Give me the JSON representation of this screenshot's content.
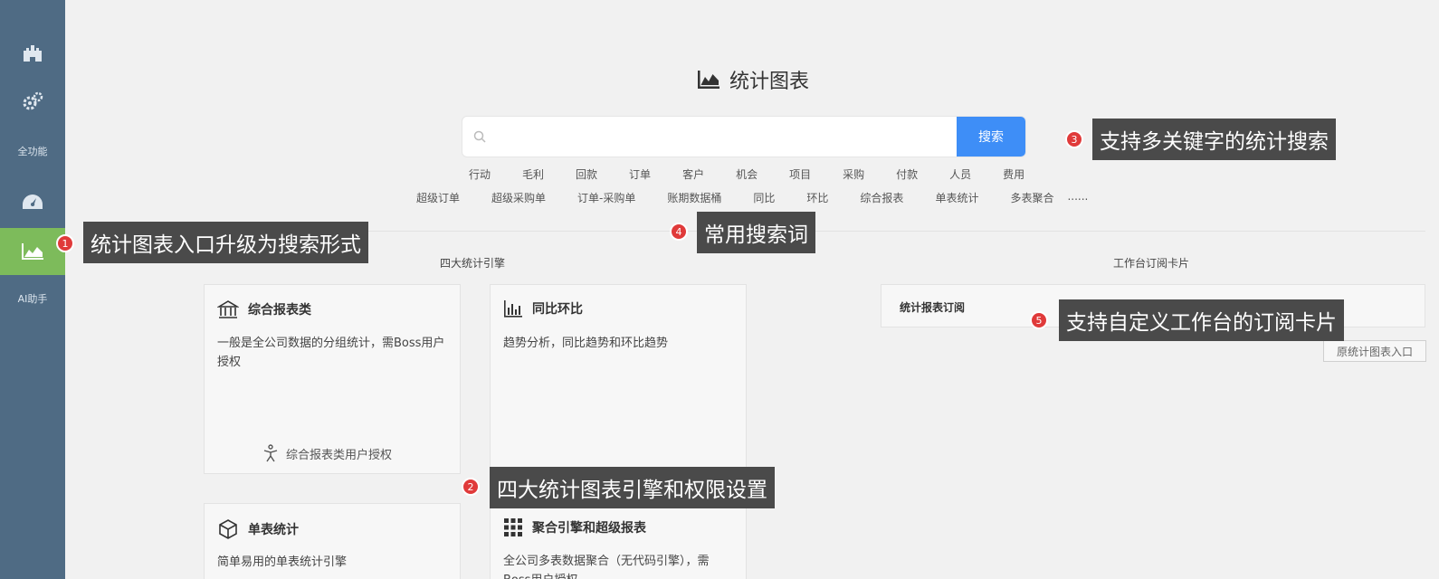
{
  "sidebar": {
    "items": [
      {
        "icon": "castle-icon"
      },
      {
        "icon": "gears-icon"
      },
      {
        "label": "全功能"
      },
      {
        "icon": "dashboard-icon"
      },
      {
        "icon": "area-chart-icon",
        "active": true
      },
      {
        "label": "AI助手"
      }
    ]
  },
  "header": {
    "title": "统计图表",
    "icon": "area-chart-icon"
  },
  "search": {
    "placeholder": "",
    "button_label": "搜索"
  },
  "keywords": {
    "row1": [
      "行动",
      "毛利",
      "回款",
      "订单",
      "客户",
      "机会",
      "项目",
      "采购",
      "付款",
      "人员",
      "费用"
    ],
    "row2": [
      "超级订单",
      "超级采购单",
      "订单-采购单",
      "账期数据桶",
      "同比",
      "环比",
      "综合报表",
      "单表统计",
      "多表聚合",
      "......"
    ]
  },
  "engines": {
    "section_title": "四大统计引擎",
    "cards": [
      {
        "title": "综合报表类",
        "icon": "bank-icon",
        "desc": "一般是全公司数据的分组统计，需Boss用户授权",
        "footer": "综合报表类用户授权",
        "footer_icon": "accessibility-icon"
      },
      {
        "title": "同比环比",
        "icon": "bar-chart-icon",
        "desc": "趋势分析，同比趋势和环比趋势"
      },
      {
        "title": "单表统计",
        "icon": "cube-icon",
        "desc": "简单易用的单表统计引擎"
      },
      {
        "title": "聚合引擎和超级报表",
        "icon": "grid-icon",
        "desc": "全公司多表数据聚合（无代码引擎），需Boss用户授权"
      }
    ]
  },
  "workbench": {
    "section_title": "工作台订阅卡片",
    "card_title": "统计报表订阅",
    "old_entry_label": "原统计图表入口"
  },
  "annotations": [
    {
      "num": "1",
      "text": "统计图表入口升级为搜索形式"
    },
    {
      "num": "2",
      "text": "四大统计图表引擎和权限设置"
    },
    {
      "num": "3",
      "text": "支持多关键字的统计搜索"
    },
    {
      "num": "4",
      "text": "常用搜索词"
    },
    {
      "num": "5",
      "text": "支持自定义工作台的订阅卡片"
    }
  ],
  "colors": {
    "sidebar": "#4f6b84",
    "active": "#7dbb5b",
    "search_button": "#3e8ef7",
    "annotation_dot": "#e03a3a",
    "annotation_bg": "#4a4a4a"
  }
}
